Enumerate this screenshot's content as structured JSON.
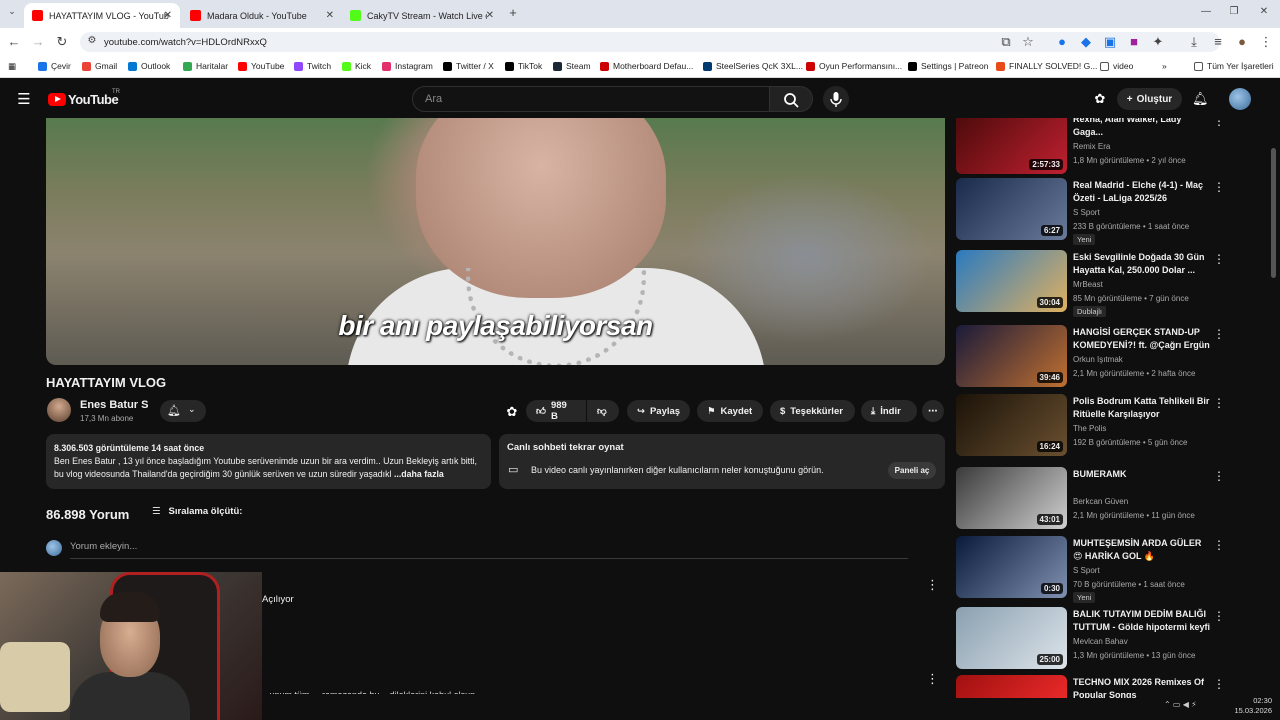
{
  "browser": {
    "tabs": [
      {
        "title": "HAYATTAYIM VLOG - YouTube",
        "active": true,
        "favicon_color": "#ff0000"
      },
      {
        "title": "Madara Olduk - YouTube",
        "active": false,
        "favicon_color": "#ff0000"
      },
      {
        "title": "CakyTV Stream - Watch Live on Kick",
        "active": false,
        "favicon_color": "#53fc18"
      }
    ],
    "new_tab": "+",
    "url": "youtube.com/watch?v=HDLOrdNRxxQ",
    "bookmarks": [
      "Çevir",
      "Gmail",
      "Outlook",
      "Haritalar",
      "YouTube",
      "Twitch",
      "Kick",
      "Instagram",
      "Twitter / X",
      "TikTok",
      "Steam",
      "Motherboard Defau...",
      "SteelSeries QcK 3XL...",
      "Oyun Performansını...",
      "Settings | Patreon",
      "FINALLY SOLVED! G...",
      "video"
    ],
    "all_bookmarks": "Tüm Yer İşaretleri"
  },
  "youtube": {
    "logo_text": "YouTube",
    "logo_tr": "TR",
    "search_placeholder": "Ara",
    "create_label": "Oluştur"
  },
  "video": {
    "caption": "bir anı paylaşabiliyorsan",
    "title": "HAYATTAYIM VLOG",
    "channel": "Enes Batur S",
    "subscribers": "17,3 Mn abone",
    "likes": "989 B",
    "share": "Paylaş",
    "save": "Kaydet",
    "thanks": "Teşekkürler",
    "download": "İndir",
    "description_meta": "8.306.503 görüntüleme  14 saat önce",
    "description_text": "Ben Enes Batur , 13 yıl önce başladığım Youtube serüvenimde uzun bir ara verdim.. Uzun Bekleyiş artık bitti, bu vlog videosunda Thailand'da geçirdiğim 30 günlük serüven ve uzun süredir yaşadıkl",
    "description_more": "...daha fazla"
  },
  "live_chat": {
    "title": "Canlı sohbeti tekrar oynat",
    "text": "Bu video canlı yayınlanırken diğer kullanıcıların neler konuştuğunu görün.",
    "button": "Paneli aç"
  },
  "comments": {
    "count": "86.898 Yorum",
    "sort_label": "Sıralama ölçütü:",
    "add_placeholder": "Yorum ekleyin...",
    "loading": "Açılıyor",
    "partial": "...unum tüm ... ramazanda hu... dileklerini kabul olsun"
  },
  "recommendations": [
    {
      "title": "Rexha, Alan Walker, Lady Gaga...",
      "channel": "Remix Era",
      "meta": "1,8 Mn görüntüleme • 2 yıl önce",
      "duration": "2:57:33",
      "badge": "",
      "thumb": [
        "#4a0a0a",
        "#c02030"
      ]
    },
    {
      "title": "Real Madrid - Elche (4-1) - Maç Özeti - LaLiga 2025/26",
      "channel": "S Sport",
      "meta": "233 B görüntüleme • 1 saat önce",
      "duration": "6:27",
      "badge": "Yeni",
      "thumb": [
        "#1a2a4a",
        "#6a7a9a"
      ]
    },
    {
      "title": "Eski Sevgilinle Doğada 30 Gün Hayatta Kal, 250.000 Dolar ...",
      "channel": "MrBeast",
      "meta": "85 Mn görüntüleme • 7 gün önce",
      "duration": "30:04",
      "badge": "Dublajlı",
      "thumb": [
        "#2a7ac0",
        "#e0b060"
      ]
    },
    {
      "title": "HANGİSİ GERÇEK STAND-UP KOMEDYENİ?! ft. @Çağrı Ergün",
      "channel": "Orkun Işıtmak",
      "meta": "2,1 Mn görüntüleme • 2 hafta önce",
      "duration": "39:46",
      "badge": "",
      "thumb": [
        "#1a1a3a",
        "#c07030"
      ]
    },
    {
      "title": "Polis Bodrum Katta Tehlikeli Bir Ritüelle Karşılaşıyor",
      "channel": "The Polis",
      "meta": "192 B görüntüleme • 5 gün önce",
      "duration": "16:24",
      "badge": "",
      "thumb": [
        "#1a1208",
        "#6a5030"
      ]
    },
    {
      "title": "BUMERAMK",
      "channel": "Berkcan Güven",
      "meta": "2,1 Mn görüntüleme • 11 gün önce",
      "duration": "43:01",
      "badge": "",
      "thumb": [
        "#3a3a3a",
        "#d0d0d0"
      ]
    },
    {
      "title": "MUHTEŞEMSİN ARDA GÜLER 😍 HARİKA GOL 🔥",
      "channel": "S Sport",
      "meta": "70 B görüntüleme • 1 saat önce",
      "duration": "0:30",
      "badge": "Yeni",
      "thumb": [
        "#0a1a3a",
        "#8090b0"
      ]
    },
    {
      "title": "BALIK TUTAYIM DEDİM BALIĞI TUTTUM - Gölde hipotermi keyfi",
      "channel": "Mevlcan Bahav",
      "meta": "1,3 Mn görüntüleme • 13 gün önce",
      "duration": "25:00",
      "badge": "",
      "thumb": [
        "#8aa0b0",
        "#dde4ea"
      ]
    },
    {
      "title": "TECHNO MIX 2026 Remixes Of Popular Songs",
      "channel": "",
      "meta": "",
      "duration": "",
      "badge": "",
      "thumb": [
        "#a01010",
        "#ff3030"
      ]
    }
  ],
  "clock": {
    "time": "02:30",
    "date": "15.03.2026"
  }
}
